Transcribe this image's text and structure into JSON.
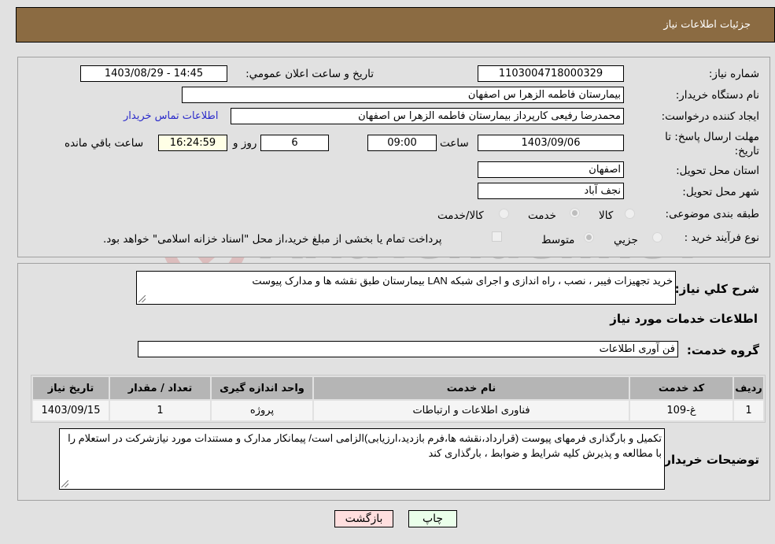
{
  "header": {
    "title": "جزئیات اطلاعات نیاز"
  },
  "info": {
    "need_number_label": "شماره نیاز:",
    "need_number": "1103004718000329",
    "announce_label": "تاریخ و ساعت اعلان عمومي:",
    "announce_value": "1403/08/29 - 14:45",
    "buyer_org_label": "نام دستگاه خریدار:",
    "buyer_org": "بیمارستان فاطمه الزهرا س  اصفهان",
    "creator_label": "ایجاد کننده درخواست:",
    "creator": "محمدرضا رفیعی کارپرداز بیمارستان فاطمه الزهرا س  اصفهان",
    "contact_link": "اطلاعات تماس خریدار",
    "deadline_label": "مهلت ارسال پاسخ: تا تاریخ:",
    "deadline_date": "1403/09/06",
    "time_label": "ساعت",
    "deadline_time": "09:00",
    "days": "6",
    "days_label": "روز و",
    "remaining_time": "16:24:59",
    "remaining_label": "ساعت باقي مانده",
    "province_label": "استان محل تحویل:",
    "province": "اصفهان",
    "city_label": "شهر محل تحویل:",
    "city": "نجف آباد",
    "category_label": "طبقه بندی موضوعی:",
    "category_options": [
      {
        "label": "کالا",
        "checked": false
      },
      {
        "label": "خدمت",
        "checked": true
      },
      {
        "label": "کالا/خدمت",
        "checked": false
      }
    ],
    "process_label": "نوع فرآیند خرید :",
    "process_options": [
      {
        "label": "جزيي",
        "checked": false
      },
      {
        "label": "متوسط",
        "checked": true
      }
    ],
    "treasury_checkbox_label": "پرداخت تمام یا بخشی از مبلغ خرید،از محل \"اسناد خزانه اسلامی\" خواهد بود.",
    "treasury_checked": false
  },
  "details": {
    "description_label": "شرح كلي نياز:",
    "description": "خرید تجهیزات فیبر ، نصب ، راه اندازی و اجرای شبکه LAN   بیمارستان طبق نقشه ها و مدارک پیوست",
    "services_title": "اطلاعات خدمات مورد نیاز",
    "service_group_label": "گروه خدمت:",
    "service_group": "فن آوری اطلاعات",
    "table": {
      "headers": [
        "ردیف",
        "کد خدمت",
        "نام خدمت",
        "واحد اندازه گیری",
        "تعداد / مقدار",
        "تاریخ نیاز"
      ],
      "rows": [
        [
          "1",
          "غ-109",
          "فناوری اطلاعات و ارتباطات",
          "پروژه",
          "1",
          "1403/09/15"
        ]
      ]
    },
    "buyer_notes_label": "توضیحات خریدار:",
    "buyer_notes": "تکمیل و بارگذاری فرمهای پیوست (قرارداد،نقشه ها،فرم بازدید،ارزیابی)الزامی است/  پیمانکار مدارک و مستندات مورد نیازشرکت در استعلام را با مطالعه و پذیرش کلیه شرایط و ضوابط ، بارگذاری کند"
  },
  "buttons": {
    "print": "چاپ",
    "back": "بازگشت"
  },
  "watermark": {
    "text": "AriaTender.neT"
  }
}
